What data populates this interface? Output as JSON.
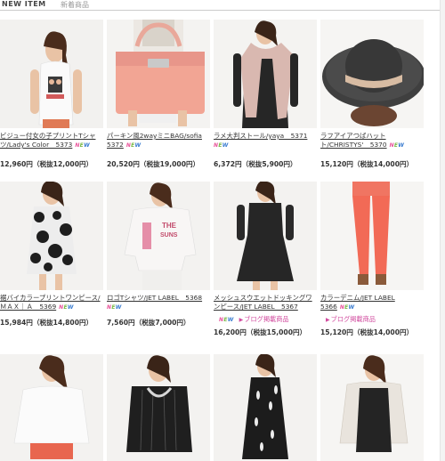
{
  "header": {
    "title_en": "NEW ITEM",
    "title_jp": "新着商品"
  },
  "new_badge": "NEW",
  "blog_label": "ブログ掲載商品",
  "products": [
    {
      "line1": "ビジュー付女の子プリントTシャ",
      "line2": "ツ/Lady's Color　5373",
      "price": "12,960円（税抜12,000円）",
      "is_new": true,
      "blog": false,
      "image": "tshirt-woman"
    },
    {
      "line1": "パーキン風2wayミニBAG/sofia",
      "line2": "5372",
      "price": "20,520円（税抜19,000円）",
      "is_new": true,
      "blog": false,
      "image": "pink-bag"
    },
    {
      "line1": "ラメ大判ストール/yaya　5371",
      "line2": "",
      "price": "6,372円（税抜5,900円）",
      "is_new": true,
      "blog": false,
      "image": "stole-woman"
    },
    {
      "line1": "ラフアイアつばハット",
      "line2": "ト/CHRISTYS'　5370",
      "price": "15,120円（税抜14,000円）",
      "is_new": true,
      "blog": false,
      "image": "straw-hat"
    },
    {
      "line1": "裾バイカラープリントワンピース/",
      "line2": "ＭＡＸ｜Ａ　5369",
      "price": "15,984円（税抜14,800円）",
      "is_new": true,
      "blog": false,
      "image": "floral-dress"
    },
    {
      "line1": "ロゴTシャツ/JET LABEL　5368",
      "line2": "",
      "price": "7,560円（税抜7,000円）",
      "is_new": true,
      "blog": false,
      "image": "logo-tee"
    },
    {
      "line1": "メッシュスウエットドッキングワ",
      "line2": "ンピース/JET LABEL　5367",
      "price": "16,200円（税抜15,000円）",
      "is_new": true,
      "blog": true,
      "image": "black-dress"
    },
    {
      "line1": "カラーデニム/JET LABEL",
      "line2": "5366",
      "price": "15,120円（税抜14,000円）",
      "is_new": true,
      "blog": true,
      "image": "coral-denim"
    },
    {
      "image": "white-knit"
    },
    {
      "image": "black-top-necklace"
    },
    {
      "image": "feather-dress"
    },
    {
      "image": "lace-cardigan"
    }
  ]
}
